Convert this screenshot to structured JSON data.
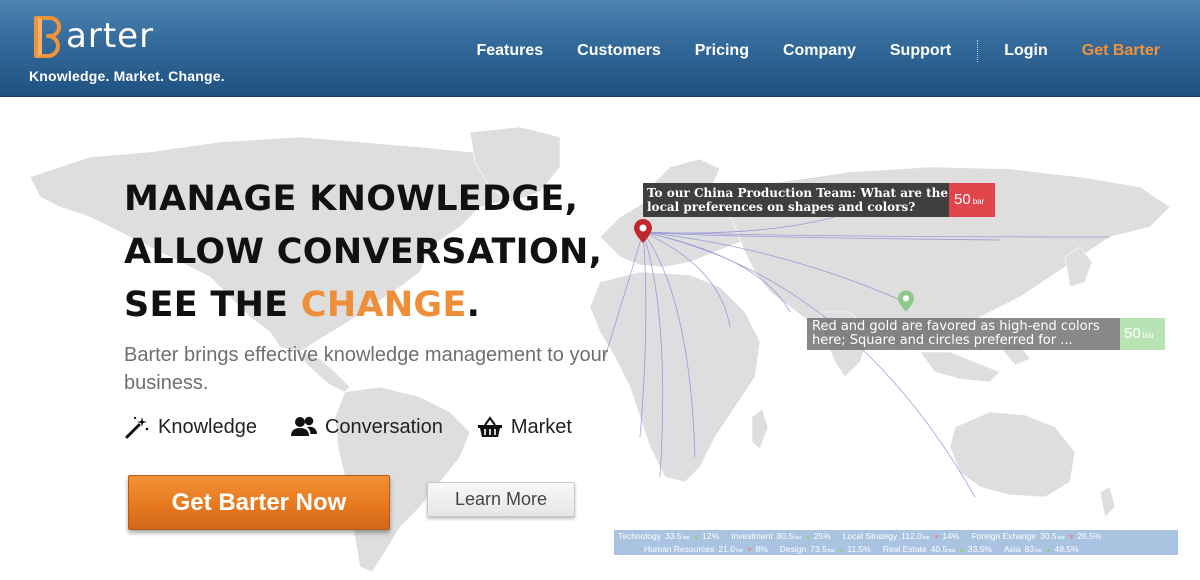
{
  "brand": {
    "logo_text": "arter",
    "logo_letter": "B",
    "tagline": "Knowledge. Market. Change."
  },
  "nav": {
    "items": [
      "Features",
      "Customers",
      "Pricing",
      "Company",
      "Support"
    ],
    "login": "Login",
    "cta": "Get Barter"
  },
  "hero": {
    "headline_line1": "MANAGE KNOWLEDGE,",
    "headline_line2": "ALLOW CONVERSATION,",
    "headline_line3_prefix": "SEE THE ",
    "headline_line3_accent": "CHANGE",
    "headline_line3_suffix": ".",
    "subtext": "Barter brings effective knowledge management to your business.",
    "features": [
      {
        "label": "Knowledge",
        "icon": "magic-wand-icon"
      },
      {
        "label": "Conversation",
        "icon": "users-icon"
      },
      {
        "label": "Market",
        "icon": "basket-icon"
      }
    ],
    "primary_button": "Get Barter Now",
    "secondary_button": "Learn More"
  },
  "callouts": [
    {
      "text": "To our China Production Team: What are the local preferences on shapes and colors?",
      "bar_value": "50",
      "bar_unit": "bar",
      "color": "#e0454b"
    },
    {
      "text": "Red and gold are favored as high-end colors here; Square and circles preferred for ...",
      "bar_value": "50",
      "bar_unit": "bar",
      "color": "#b8e3b2"
    }
  ],
  "ticker": {
    "row1": [
      {
        "name": "Technology",
        "value": "33.5",
        "unit": "bar",
        "dir": "up",
        "change": "12%"
      },
      {
        "name": "Investment",
        "value": "80.5",
        "unit": "bar",
        "dir": "up",
        "change": "25%"
      },
      {
        "name": "Local Strategy",
        "value": "112.0",
        "unit": "bar",
        "dir": "down",
        "change": "14%"
      },
      {
        "name": "Foreign Exhange",
        "value": "30.5",
        "unit": "bar",
        "dir": "down",
        "change": "28.5%"
      }
    ],
    "row2": [
      {
        "name": "Human Resources",
        "value": "21.0",
        "unit": "bar",
        "dir": "down",
        "change": "8%"
      },
      {
        "name": "Design",
        "value": "73.5",
        "unit": "bar",
        "dir": "up",
        "change": "11.5%"
      },
      {
        "name": "Real Estate",
        "value": "40.5",
        "unit": "bar",
        "dir": "up",
        "change": "33.5%"
      },
      {
        "name": "Asia",
        "value": "83",
        "unit": "bar",
        "dir": "up",
        "change": "48.5%"
      }
    ]
  },
  "colors": {
    "accent": "#ee8e38",
    "header": "#336a9a",
    "pin_red": "#c0282e",
    "pin_green": "#8fc98a"
  }
}
